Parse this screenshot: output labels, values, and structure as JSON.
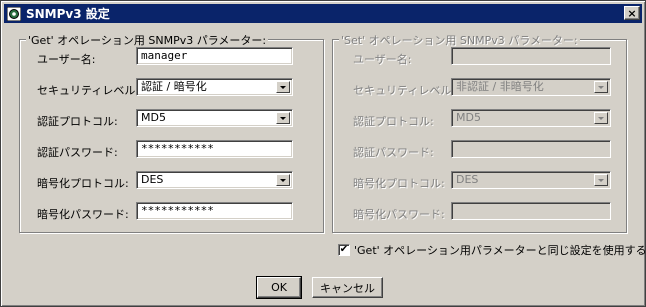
{
  "window": {
    "title": "SNMPv3 設定",
    "close_label": "×"
  },
  "get_group": {
    "legend": "'Get' オペレーション用 SNMPv3 パラメーター:",
    "username_label": "ユーザー名:",
    "username_value": "manager",
    "security_level_label": "セキュリティレベル:",
    "security_level_value": "認証 / 暗号化",
    "auth_protocol_label": "認証プロトコル:",
    "auth_protocol_value": "MD5",
    "auth_password_label": "認証パスワード:",
    "auth_password_value": "***********",
    "priv_protocol_label": "暗号化プロトコル:",
    "priv_protocol_value": "DES",
    "priv_password_label": "暗号化パスワード:",
    "priv_password_value": "***********"
  },
  "set_group": {
    "legend": "'Set' オペレーション用 SNMPv3 パラメーター:",
    "username_label": "ユーザー名:",
    "username_value": "",
    "security_level_label": "セキュリティレベル:",
    "security_level_value": "非認証 / 非暗号化",
    "auth_protocol_label": "認証プロトコル:",
    "auth_protocol_value": "MD5",
    "auth_password_label": "認証パスワード:",
    "auth_password_value": "",
    "priv_protocol_label": "暗号化プロトコル:",
    "priv_protocol_value": "DES",
    "priv_password_label": "暗号化パスワード:",
    "priv_password_value": ""
  },
  "use_get_params": {
    "label": "'Get' オペレーション用パラメーターと同じ設定を使用する(S)",
    "checked": true,
    "check_mark": "✔"
  },
  "buttons": {
    "ok_label": "OK",
    "cancel_label": "キャンセル"
  }
}
